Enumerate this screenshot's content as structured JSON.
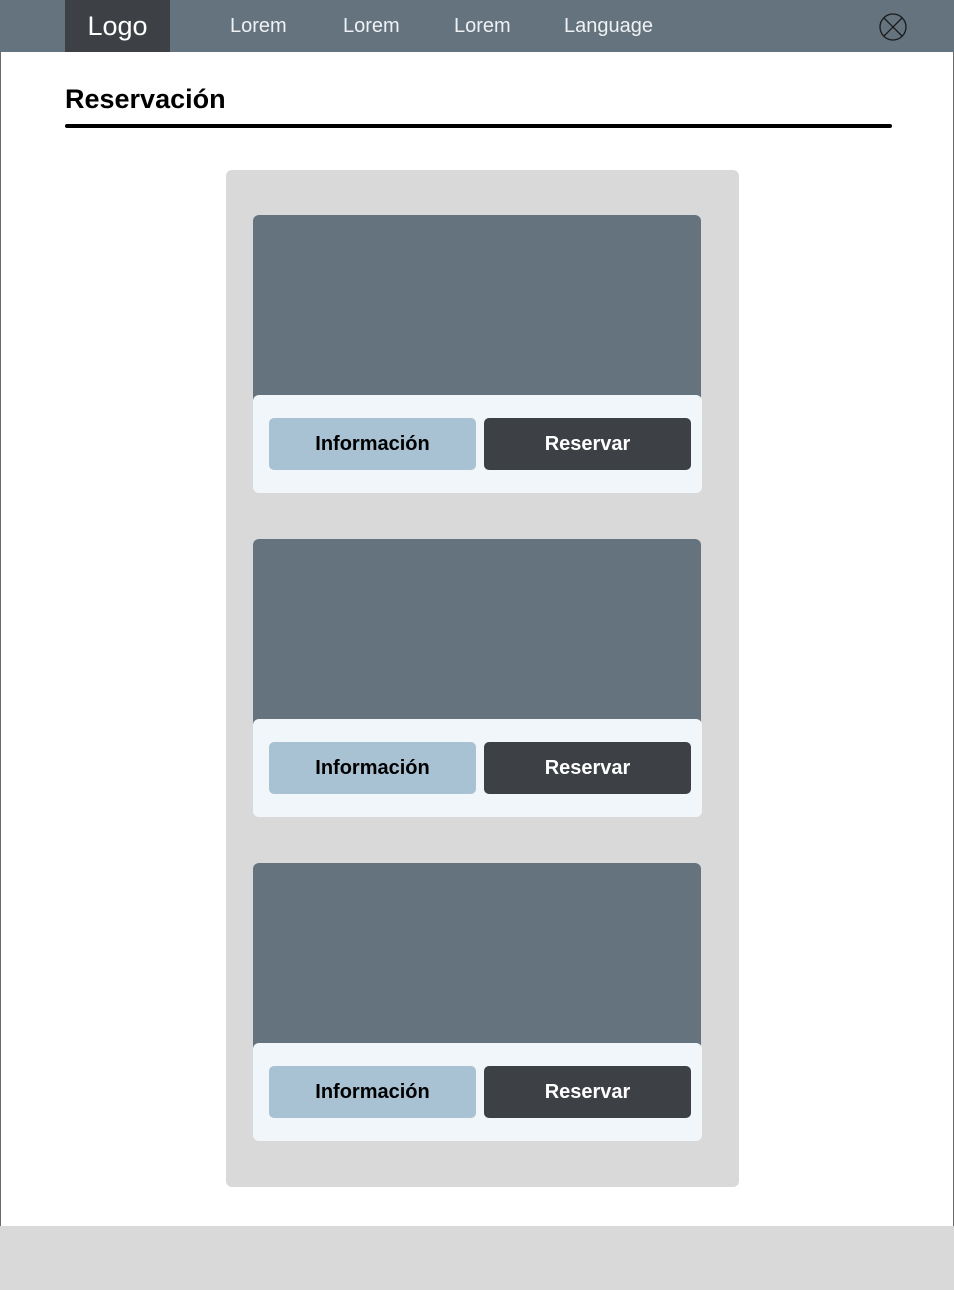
{
  "header": {
    "logo": "Logo",
    "nav": [
      "Lorem",
      "Lorem",
      "Lorem",
      "Language"
    ],
    "close_icon": "circle-x-icon"
  },
  "page": {
    "title": "Reservación"
  },
  "cards": [
    {
      "info_label": "Información",
      "reserve_label": "Reservar"
    },
    {
      "info_label": "Información",
      "reserve_label": "Reservar"
    },
    {
      "info_label": "Información",
      "reserve_label": "Reservar"
    }
  ],
  "colors": {
    "topbar": "#64737e",
    "logo_bg": "#3d4145",
    "panel_bg": "#d9d9d9",
    "card_image": "#64737e",
    "card_actions_bg": "#f1f6fa",
    "info_button": "#a8c1d3",
    "reserve_button": "#3d4145",
    "footer": "#d9d9d9"
  }
}
